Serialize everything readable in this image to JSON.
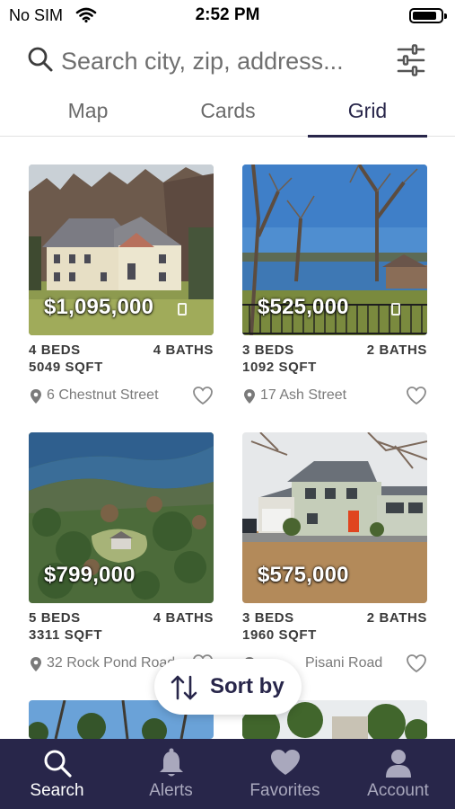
{
  "status_bar": {
    "carrier": "No SIM",
    "time": "2:52 PM",
    "battery_level": 0.85
  },
  "search": {
    "placeholder": "Search city, zip, address..."
  },
  "tabs": [
    {
      "label": "Map",
      "active": false
    },
    {
      "label": "Cards",
      "active": false
    },
    {
      "label": "Grid",
      "active": true
    }
  ],
  "listings": [
    {
      "price": "$1,095,000",
      "beds": "4 BEDS",
      "baths": "4 BATHS",
      "sqft": "5049 SQFT",
      "address": "6 Chestnut Street",
      "favorited": false
    },
    {
      "price": "$525,000",
      "beds": "3 BEDS",
      "baths": "2 BATHS",
      "sqft": "1092 SQFT",
      "address": "17 Ash Street",
      "favorited": false
    },
    {
      "price": "$799,000",
      "beds": "5 BEDS",
      "baths": "4 BATHS",
      "sqft": "3311 SQFT",
      "address": "32 Rock Pond Road",
      "favorited": false
    },
    {
      "price": "$575,000",
      "beds": "3 BEDS",
      "baths": "2 BATHS",
      "sqft": "1960 SQFT",
      "address": "Pisani Road",
      "favorited": false
    }
  ],
  "sort_button": {
    "label": "Sort by"
  },
  "bottom_nav": [
    {
      "label": "Search",
      "icon": "search-icon",
      "active": true
    },
    {
      "label": "Alerts",
      "icon": "bell-icon",
      "active": false
    },
    {
      "label": "Favorites",
      "icon": "heart-icon",
      "active": false
    },
    {
      "label": "Account",
      "icon": "person-icon",
      "active": false
    }
  ],
  "colors": {
    "primary": "#28264a",
    "inactive_nav": "#a9a8bd",
    "muted_text": "#7a7a7a"
  }
}
